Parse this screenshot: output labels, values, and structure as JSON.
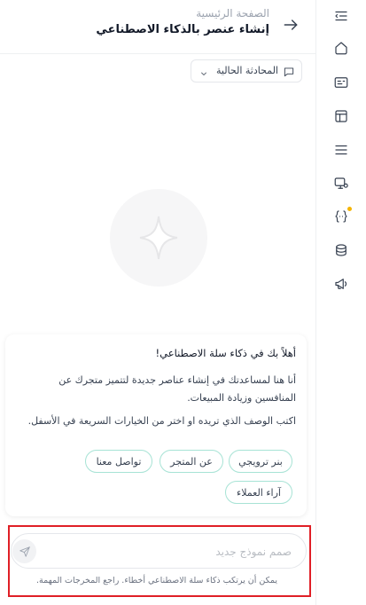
{
  "header": {
    "breadcrumb": "الصفحة الرئيسية",
    "title": "إنشاء عنصر بالذكاء الاصطناعي"
  },
  "conversation": {
    "label": "المحادثة الحالية"
  },
  "welcome": {
    "title": "أهلاً بك في ذكاء سلة الاصطناعي!",
    "p1": "أنا هنا لمساعدتك في إنشاء عناصر جديدة لتتميز متجرك عن المنافسين وزيادة المبيعات.",
    "p2": "اكتب الوصف الذي تريده او اختر من الخيارات السريعة في الأسفل."
  },
  "quick_options": [
    "بنر ترويجي",
    "عن المتجر",
    "تواصل معنا",
    "آراء العملاء"
  ],
  "composer": {
    "placeholder": "صمم نموذج جديد",
    "value": "",
    "disclaimer": "يمكن أن يرتكب ذكاء سلة الاصطناعي أخطاء. راجع المخرجات المهمة."
  },
  "rail_icons": [
    "menu-collapse-icon",
    "home-icon",
    "id-card-icon",
    "layout-icon",
    "list-icon",
    "monitor-settings-icon",
    "code-braces-icon",
    "box-icon",
    "megaphone-icon"
  ],
  "colors": {
    "accent_border": "#a7e3d5",
    "badge_dot": "#f5b400",
    "highlight": "#e01f26"
  }
}
